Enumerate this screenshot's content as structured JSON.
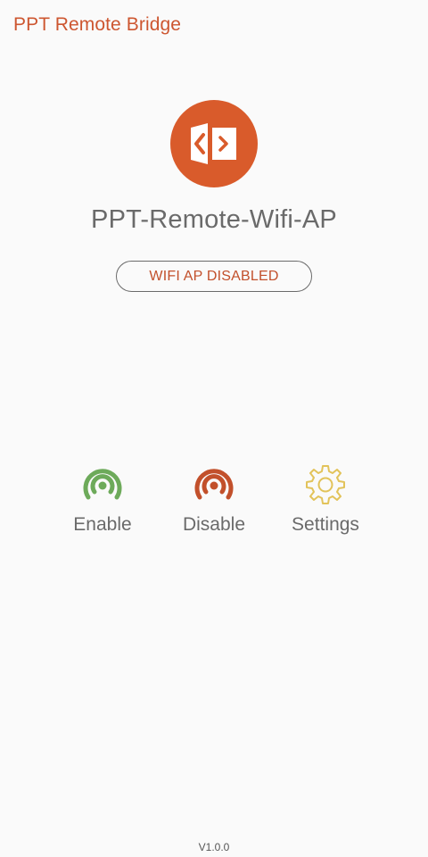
{
  "app": {
    "title": "PPT Remote Bridge",
    "ap_name": "PPT-Remote-Wifi-AP",
    "status": "WIFI AP DISABLED",
    "version": "V1.0.0"
  },
  "actions": [
    {
      "label": "Enable",
      "icon": "wifi-ap-enable-icon",
      "color": "#6daa5a"
    },
    {
      "label": "Disable",
      "icon": "wifi-ap-disable-icon",
      "color": "#c2502b"
    },
    {
      "label": "Settings",
      "icon": "gear-icon",
      "color": "#e2c35a"
    }
  ],
  "colors": {
    "accent": "#d95b2b",
    "text_gray": "#6a6a6a",
    "background": "#fafafa"
  }
}
